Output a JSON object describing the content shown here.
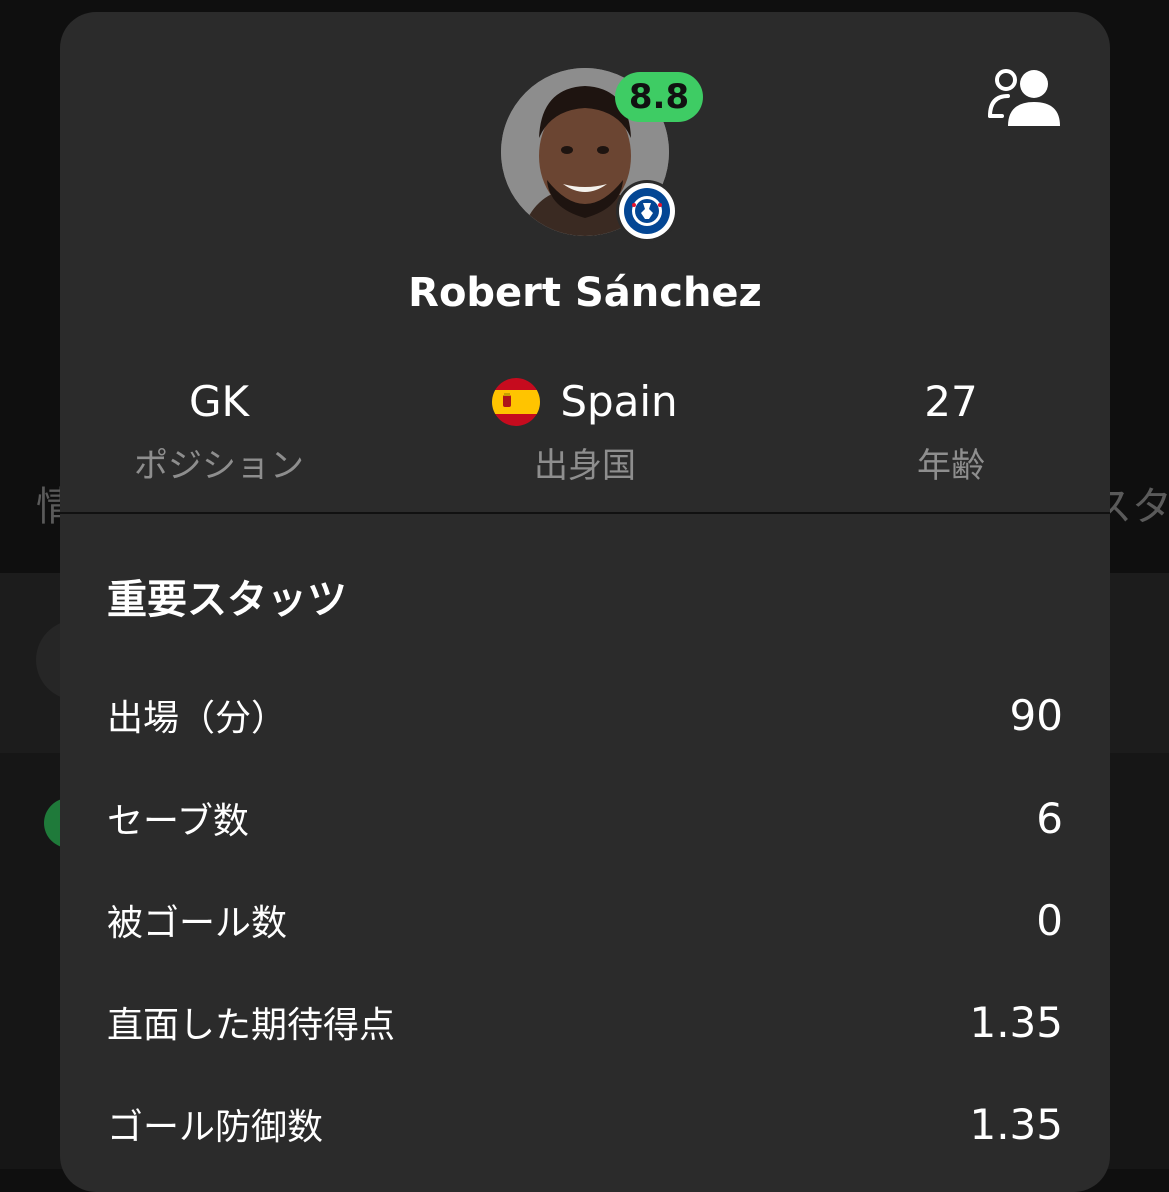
{
  "background": {
    "tab_left": "情",
    "tab_right": "スタ"
  },
  "player": {
    "rating": "8.8",
    "name": "Robert Sánchez",
    "club_badge": "chelsea-badge",
    "position": {
      "value": "GK",
      "label": "ポジション"
    },
    "country": {
      "value": "Spain",
      "label": "出身国",
      "flag": "spain-flag"
    },
    "age": {
      "value": "27",
      "label": "年齢"
    }
  },
  "colors": {
    "card": "#2b2b2b",
    "rating_badge": "#3ecc64",
    "label_gray": "#8e8e8e"
  },
  "key_stats": {
    "title": "重要スタッツ",
    "rows": [
      {
        "label": "出場（分）",
        "value": "90"
      },
      {
        "label": "セーブ数",
        "value": "6"
      },
      {
        "label": "被ゴール数",
        "value": "0"
      },
      {
        "label": "直面した期待得点",
        "value": "1.35"
      },
      {
        "label": "ゴール防御数",
        "value": "1.35"
      }
    ]
  }
}
